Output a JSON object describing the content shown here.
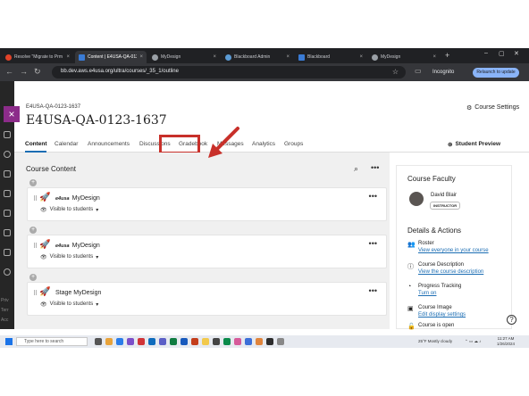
{
  "browser": {
    "tabs": [
      {
        "label": "Resolve \"Migrate to Prm",
        "active": false
      },
      {
        "label": "Content | E4USA-QA-0123-1",
        "active": true
      },
      {
        "label": "MyDesign",
        "active": false
      },
      {
        "label": "Blackboard Admin",
        "active": false
      },
      {
        "label": "Blackboard",
        "active": false
      },
      {
        "label": "MyDesign",
        "active": false
      }
    ],
    "new_tab": "+",
    "url": "bb.dev.aws.e4usa.org/ultra/courses/_35_1/outline",
    "incognito_label": "Incognito",
    "update_button": "Relaunch to update"
  },
  "rail": {
    "close_glyph": "×",
    "bottom_texts": [
      "Priv",
      "Terr",
      "Acc"
    ]
  },
  "course": {
    "id": "E4USA-QA-0123-1637",
    "title": "E4USA-QA-0123-1637",
    "settings_label": "Course Settings",
    "student_preview_label": "Student Preview",
    "tabs": [
      "Content",
      "Calendar",
      "Announcements",
      "Discussions",
      "Gradebook",
      "Messages",
      "Analytics",
      "Groups"
    ],
    "active_tab": "Content",
    "highlighted_tab": "Gradebook"
  },
  "content": {
    "title": "Course Content",
    "items": [
      {
        "brand": "e4usa",
        "name": "MyDesign",
        "visibility": "Visible to students"
      },
      {
        "brand": "e4usa",
        "name": "MyDesign",
        "visibility": "Visible to students"
      },
      {
        "brand": "",
        "name": "Stage MyDesign",
        "visibility": "Visible to students"
      }
    ]
  },
  "side": {
    "faculty_heading": "Course Faculty",
    "faculty_name": "David Blair",
    "faculty_role": "INSTRUCTOR",
    "details_heading": "Details & Actions",
    "details": [
      {
        "icon": "roster-icon",
        "glyph": "👥",
        "title": "Roster",
        "link": "View everyone in your course"
      },
      {
        "icon": "info-icon",
        "glyph": "ⓘ",
        "title": "Course Description",
        "link": "View the course description"
      },
      {
        "icon": "progress-icon",
        "glyph": "◔",
        "title": "Progress Tracking",
        "link": "Turn on"
      },
      {
        "icon": "image-icon",
        "glyph": "▣",
        "title": "Course Image",
        "link": "Edit display settings"
      },
      {
        "icon": "lock-icon",
        "glyph": "🔓",
        "title": "Course is open",
        "link": ""
      }
    ],
    "help": "?"
  },
  "taskbar": {
    "search_placeholder": "Type here to search",
    "weather": "25°F  Mostly cloudy",
    "time": "11:27 AM",
    "date": "1/26/2024"
  },
  "colors": {
    "accent": "#1b6db3",
    "brand": "#8c2c8a",
    "annotation": "#c8302a"
  }
}
